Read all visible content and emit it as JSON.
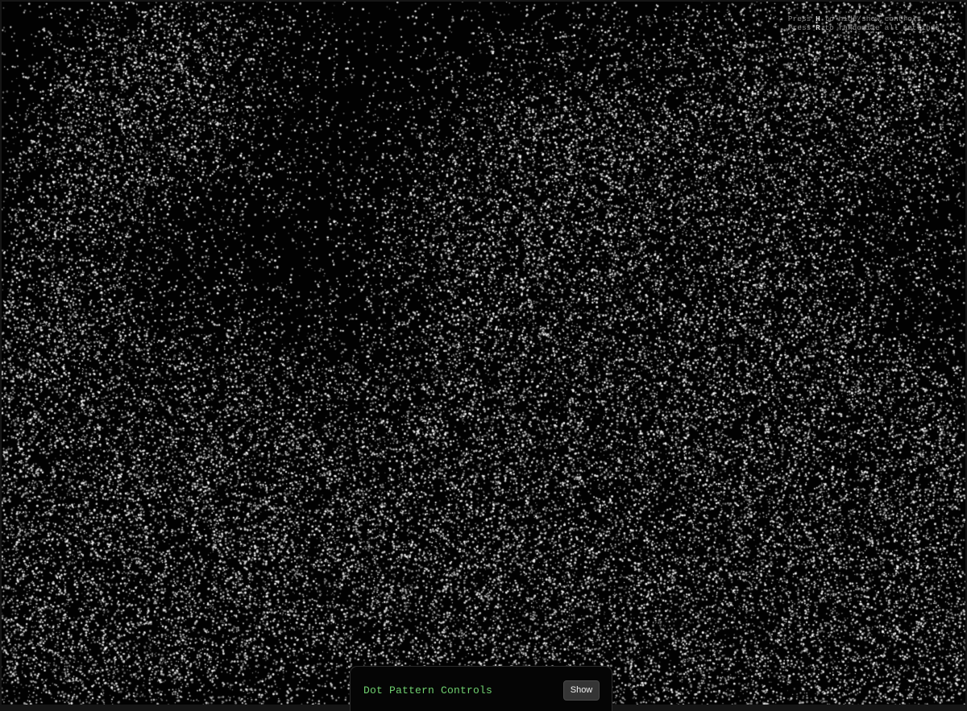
{
  "hints": {
    "line1": {
      "prefix": "Press ",
      "key": "H",
      "suffix": " to hide/show controls"
    },
    "line2": {
      "prefix": "Press ",
      "key": "R",
      "suffix": " to randomize all settings"
    }
  },
  "controls_panel": {
    "title": "Dot Pattern Controls",
    "toggle_label": "Show"
  },
  "colors": {
    "background": "#000000",
    "dot": "#ffffff",
    "title_accent": "#6fcf6f",
    "hint_text": "#8a8a8a",
    "button_bg": "#353535"
  }
}
